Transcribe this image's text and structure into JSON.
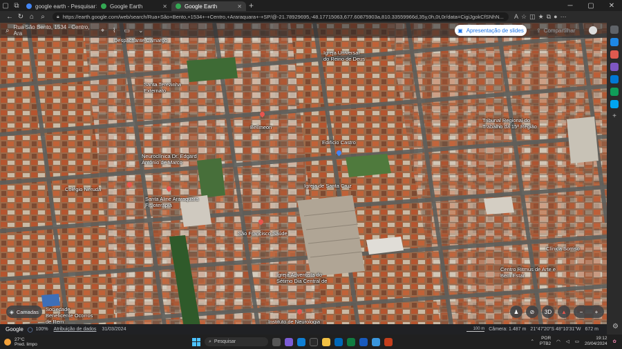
{
  "browser": {
    "tabs": [
      {
        "label": "google earth - Pesquisar",
        "active": false,
        "color": "#4285f4"
      },
      {
        "label": "Google Earth",
        "active": false,
        "color": "#34a853"
      },
      {
        "label": "Google Earth",
        "active": true,
        "color": "#34a853"
      }
    ],
    "url": "https://earth.google.com/web/search/Rua+São+Bento,+1534+-+Centro,+Araraquara+-+SP/@-21.78929695,-48.17715063,677.60875903a,810.33559966d,35y,0h,0t,0r/data=CigiJgokCfSNhN..."
  },
  "earth": {
    "search_placeholder": "Rua São Bento, 1534 - Centro, Ara",
    "present_label": "Apresentação de slides",
    "share_label": "Compartilhar",
    "layers_label": "Camadas",
    "threed_label": "3D",
    "labels": [
      {
        "text": "Despachante Camargo"
      },
      {
        "text": "Igreja Universal do Reino de Deus"
      },
      {
        "text": "Santa Terezinha Externato"
      },
      {
        "text": "Tribunal Regional do Trabalho da 15ª Região"
      },
      {
        "text": "Bellmeon"
      },
      {
        "text": "Edifício Castro"
      },
      {
        "text": "Neuroclínica Dr. Edgard Antônio de Marco"
      },
      {
        "text": "Colégio Neruda"
      },
      {
        "text": "Igreja de Santa Cruz"
      },
      {
        "text": "Santa Aline Araraquara Fisioterapia"
      },
      {
        "text": "São Francisco Saúde"
      },
      {
        "text": "Clínica Sorriso"
      },
      {
        "text": "Centro Ritmus de Arte e Bem Estar"
      },
      {
        "text": "Igreja Adventista do Sétimo Dia Central de"
      },
      {
        "text": "Sociedade Beneficente Ocorros de Rem"
      },
      {
        "text": "Instituto de Neurologia"
      }
    ]
  },
  "status": {
    "logo": "Google",
    "zoom": "100%",
    "attribution": "Atribuição de dados",
    "date": "31/03/2024",
    "scale": "100 m",
    "camera": "Câmera: 1.487 m",
    "coords": "21°47'20\"S 48°10'31\"W",
    "elevation": "672 m"
  },
  "taskbar": {
    "temp": "27°C",
    "weather": "Pred. limpo",
    "search": "Pesquisar",
    "lang": "POR",
    "lang2": "PTB2",
    "time": "19:12",
    "date": "20/04/2024"
  }
}
